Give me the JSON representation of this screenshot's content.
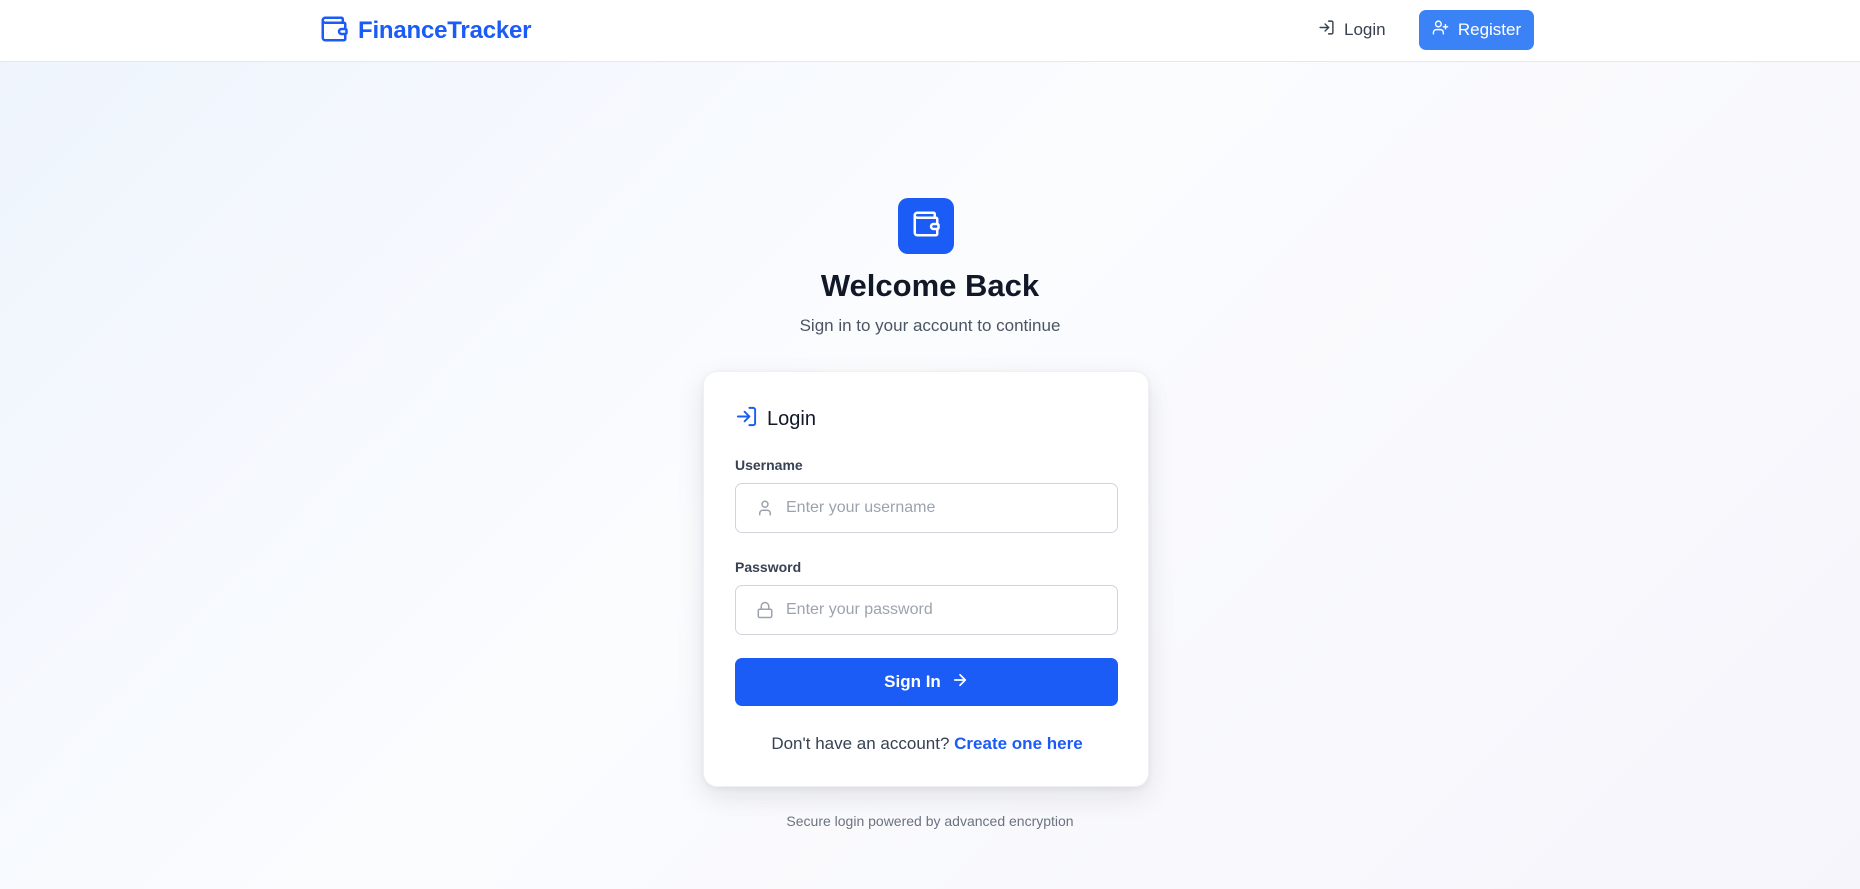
{
  "colors": {
    "primary": "#1a5cf5",
    "register_button": "#3b82f6",
    "text_dark": "#111827",
    "text_muted": "#6b7280"
  },
  "navbar": {
    "brand_icon": "wallet-icon",
    "brand_name": "FinanceTracker",
    "login_icon": "log-in-icon",
    "login_label": "Login",
    "register_icon": "user-plus-icon",
    "register_label": "Register"
  },
  "hero": {
    "icon": "wallet-icon",
    "title": "Welcome Back",
    "subtitle": "Sign in to your account to continue"
  },
  "card": {
    "header_icon": "log-in-icon",
    "title": "Login",
    "username": {
      "label": "Username",
      "icon": "user-icon",
      "placeholder": "Enter your username",
      "value": ""
    },
    "password": {
      "label": "Password",
      "icon": "lock-icon",
      "placeholder": "Enter your password",
      "value": ""
    },
    "submit": {
      "label": "Sign In",
      "icon": "arrow-right-icon"
    },
    "signup_prompt": "Don't have an account?",
    "signup_link": "Create one here"
  },
  "footer": {
    "note": "Secure login powered by advanced encryption"
  }
}
